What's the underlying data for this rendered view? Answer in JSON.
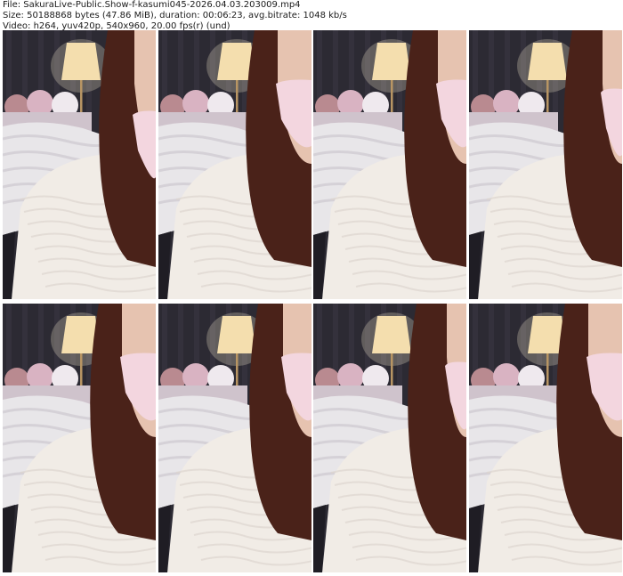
{
  "info": {
    "file_line": "File: SakuraLive-Public.Show-f-kasumi045-2026.04.03.203009.mp4",
    "size_line": "Size: 50188868 bytes (47.86 MiB), duration: 00:06:23, avg.bitrate: 1048 kb/s",
    "video_line": "Video: h264, yuv420p, 540x960, 20.00 fps(r) (und)"
  },
  "frames": [
    {
      "variant": "a"
    },
    {
      "variant": "b"
    },
    {
      "variant": "c"
    },
    {
      "variant": "d"
    },
    {
      "variant": "b"
    },
    {
      "variant": "c"
    },
    {
      "variant": "d"
    },
    {
      "variant": "b"
    }
  ],
  "colors": {
    "wall": "#2c2a33",
    "lamp_shade": "#f4deae",
    "lamp_glow": "#fff6d8",
    "blanket": "#e8e6e9",
    "sweater": "#f1ece6",
    "hair": "#4a2219",
    "mask": "#f3d6df",
    "skin": "#e6c3b0",
    "plush_pink": "#d9b3c2",
    "plush_white": "#efe9ee"
  }
}
